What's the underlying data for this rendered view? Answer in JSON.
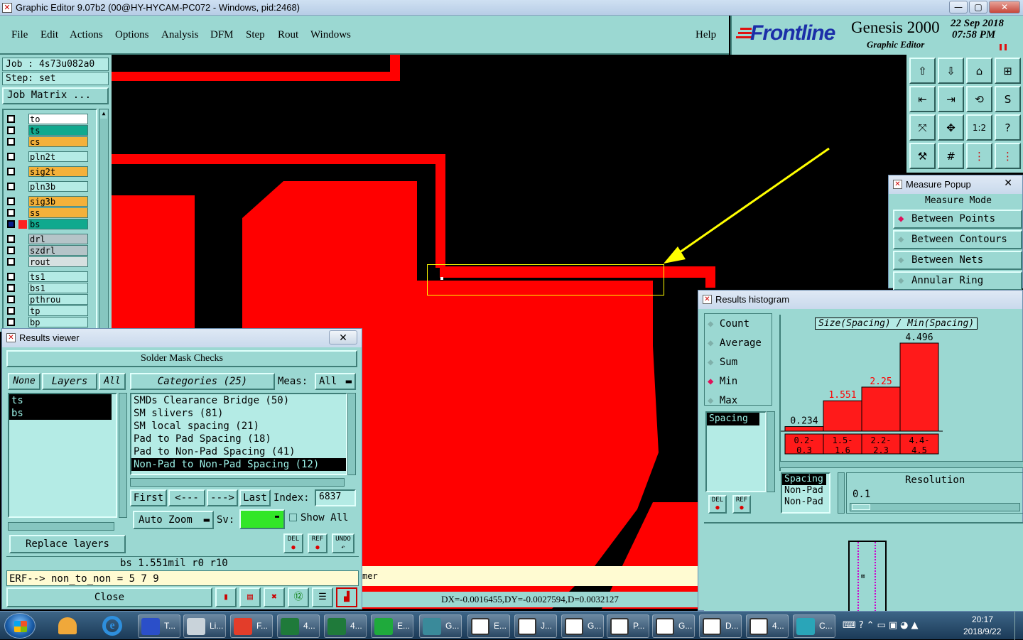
{
  "window": {
    "title": "Graphic Editor 9.07b2 (00@HY-HYCAM-PC072 - Windows, pid:2468)",
    "min": "—",
    "max": "▢",
    "close": "✕"
  },
  "menu": [
    "File",
    "Edit",
    "Actions",
    "Options",
    "Analysis",
    "DFM",
    "Step",
    "Rout",
    "Windows"
  ],
  "menu_help": "Help",
  "brand": {
    "logo": "Frontline",
    "product": "Genesis 2000",
    "subtitle": "Graphic Editor",
    "date": "22 Sep 2018",
    "time": "07:58 PM"
  },
  "job": {
    "job_label": "Job : 4s73u082a0",
    "step_label": "Step: set",
    "matrix_button": "Job Matrix ..."
  },
  "layers": [
    {
      "name": "to",
      "color": "#ffffff"
    },
    {
      "name": "ts",
      "color": "#10a98e"
    },
    {
      "name": "cs",
      "color": "#f4b13a"
    },
    {
      "name": "pln2t",
      "color": "#b4ebe5"
    },
    {
      "name": "sig2t",
      "color": "#f4b13a"
    },
    {
      "name": "pln3b",
      "color": "#b4ebe5"
    },
    {
      "name": "sig3b",
      "color": "#f4b13a"
    },
    {
      "name": "ss",
      "color": "#f4b13a"
    },
    {
      "name": "bs",
      "color": "#10a98e"
    },
    {
      "name": "drl",
      "color": "#b5c4c8"
    },
    {
      "name": "szdrl",
      "color": "#b5c4c8"
    },
    {
      "name": "rout",
      "color": "#d6e0e0"
    },
    {
      "name": "ts1",
      "color": "#b4ebe5"
    },
    {
      "name": "bs1",
      "color": "#b4ebe5"
    },
    {
      "name": "pthrou",
      "color": "#b4ebe5"
    },
    {
      "name": "tp",
      "color": "#b4ebe5"
    },
    {
      "name": "bp",
      "color": "#b4ebe5"
    }
  ],
  "colors": {
    "panel": "#9bd8d2",
    "copper": "#ff0000",
    "highlight": "#ffff00",
    "field": "#b4ebe5"
  },
  "measure_popup": {
    "title": "Measure Popup",
    "mode_label": "Measure Mode",
    "options": [
      "Between Points",
      "Between Contours",
      "Between Nets",
      "Annular Ring"
    ],
    "selected": "Between Points"
  },
  "results_viewer": {
    "title": "Results viewer",
    "header": "Solder Mask Checks",
    "none_btn": "None",
    "layers_btn": "Layers",
    "all_btn": "All",
    "categories_btn": "Categories (25)",
    "meas_label": "Meas:",
    "meas_value": "All",
    "layer_list": [
      "ts",
      "bs"
    ],
    "categories": [
      "SMDs Clearance Bridge (50)",
      "SM slivers (81)",
      "SM local spacing (21)",
      "Pad to Pad Spacing (18)",
      "Pad to Non-Pad Spacing (41)",
      "Non-Pad to Non-Pad Spacing (12)"
    ],
    "selected_category": "Non-Pad to Non-Pad Spacing (12)",
    "nav": {
      "first": "First",
      "prev": "<---",
      "next": "--->",
      "last": "Last",
      "index_label": "Index:",
      "index_value": "6837"
    },
    "auto_zoom": "Auto Zoom",
    "sv_label": "Sv:",
    "show_all": "Show All",
    "replace_layers": "Replace layers",
    "del": "DEL",
    "ref": "REF",
    "undo": "UNDO",
    "status": "bs 1.551mil   r0   r10",
    "erf": "ERF--> non_to_non = 5 7 9",
    "close": "Close"
  },
  "histogram": {
    "title": "Results histogram",
    "modes": [
      "Count",
      "Average",
      "Sum",
      "Min",
      "Max"
    ],
    "selected_mode": "Min",
    "chart_title": "Size(Spacing) / Min(Spacing)",
    "list": [
      "Spacing"
    ],
    "list2": [
      "Spacing",
      "Non-Pad",
      "Non-Pad"
    ],
    "resolution_label": "Resolution",
    "resolution_value": "0.1",
    "del": "DEL",
    "ref": "REF"
  },
  "chart_data": {
    "type": "bar",
    "title": "Size(Spacing) / Min(Spacing)",
    "categories": [
      "0.2-0.3",
      "1.5-1.6",
      "2.2-2.3",
      "4.4-4.5"
    ],
    "values": [
      0.234,
      1.551,
      2.25,
      4.496
    ],
    "value_labels": [
      "0.234",
      "1.551",
      "2.25",
      "4.496"
    ],
    "label_colors": [
      "#000000",
      "#ff0000",
      "#ff0000",
      "#000000"
    ]
  },
  "status_bar": {
    "hint": "mer",
    "measure": "DX=-0.0016455,DY=-0.0027594,D=0.0032127"
  },
  "taskbar": {
    "items": [
      {
        "label": "T...",
        "icon": "disk-icon"
      },
      {
        "label": "Li...",
        "icon": "scroll-icon"
      },
      {
        "label": "F...",
        "icon": "f-icon"
      },
      {
        "label": "4...",
        "icon": "excel-icon"
      },
      {
        "label": "4...",
        "icon": "excel-icon"
      },
      {
        "label": "E...",
        "icon": "frontline-icon"
      },
      {
        "label": "G...",
        "icon": "eye-icon"
      },
      {
        "label": "E...",
        "icon": "x-window-icon"
      },
      {
        "label": "J...",
        "icon": "x-window-icon"
      },
      {
        "label": "G...",
        "icon": "x-window-icon"
      },
      {
        "label": "P...",
        "icon": "x-window-icon"
      },
      {
        "label": "G...",
        "icon": "x-window-icon"
      },
      {
        "label": "D...",
        "icon": "x-window-icon"
      },
      {
        "label": "4...",
        "icon": "x-window-icon"
      },
      {
        "label": "C...",
        "icon": "genesis-icon"
      }
    ],
    "clock_time": "20:17",
    "clock_date": "2018/9/22"
  }
}
